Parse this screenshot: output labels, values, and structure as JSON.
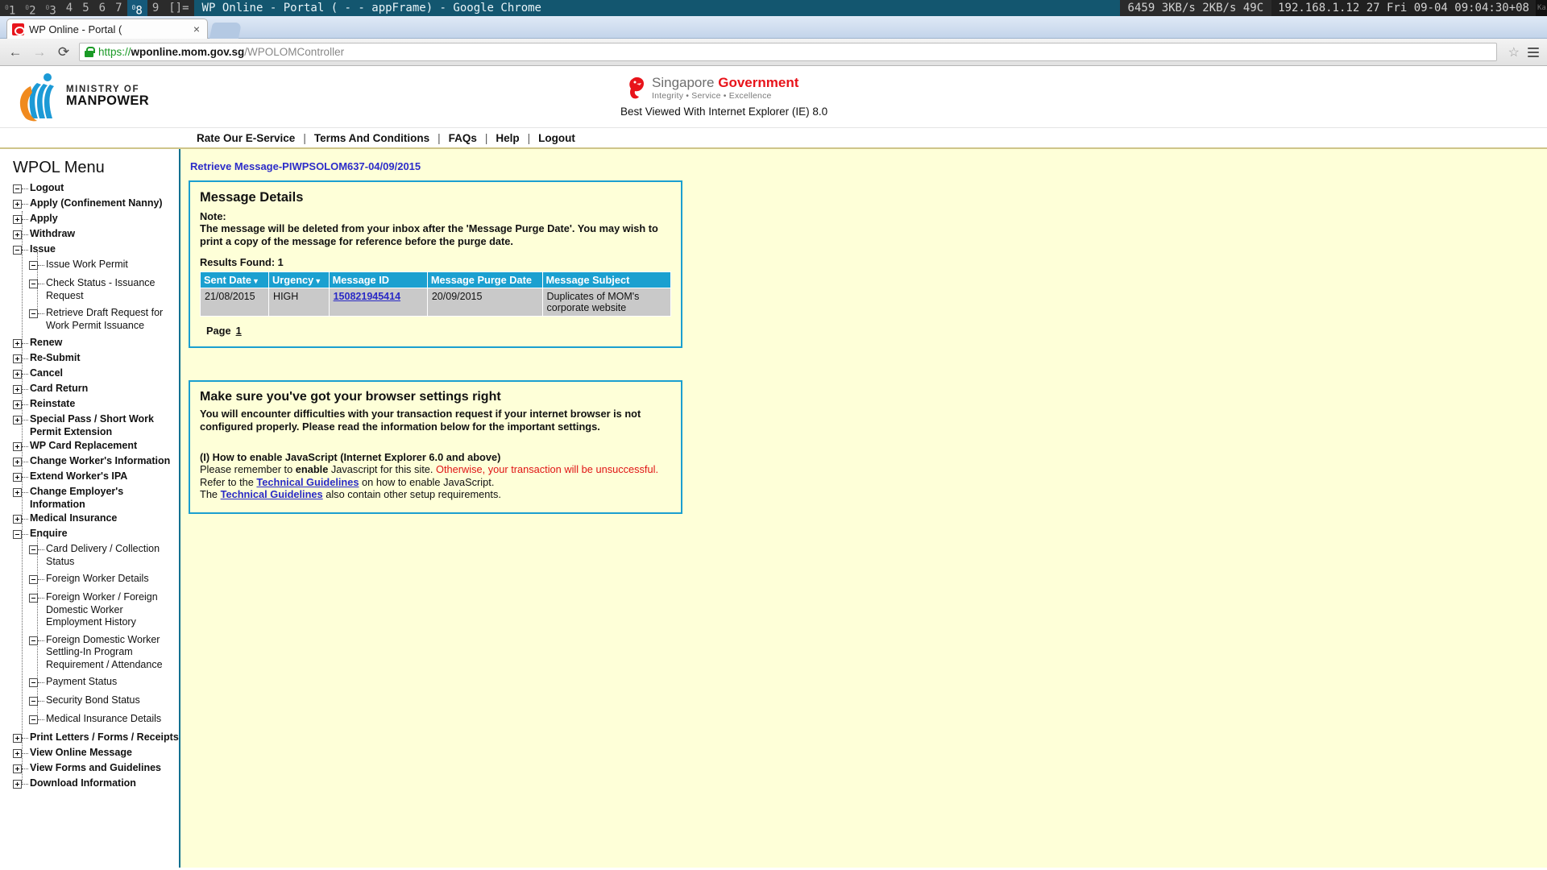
{
  "wm": {
    "workspaces": [
      {
        "sup": "0",
        "num": "1",
        "active": false
      },
      {
        "sup": "0",
        "num": "2",
        "active": false
      },
      {
        "sup": "0",
        "num": "3",
        "active": false
      },
      {
        "sup": "",
        "num": "4",
        "active": false
      },
      {
        "sup": "",
        "num": "5",
        "active": false
      },
      {
        "sup": "",
        "num": "6",
        "active": false
      },
      {
        "sup": "",
        "num": "7",
        "active": false
      },
      {
        "sup": "0",
        "num": "8",
        "active": true
      },
      {
        "sup": "",
        "num": "9",
        "active": false
      }
    ],
    "layout": "[]=",
    "window_title": "WP Online - Portal ( - - appFrame) - Google Chrome",
    "stats": "6459 3KB/s 2KB/s 49C",
    "clock": "192.168.1.12 27 Fri 09-04 09:04:30+08",
    "corner": "Kai"
  },
  "browser": {
    "tab_title": "WP Online - Portal (",
    "tab_close": "×",
    "back_icon": "←",
    "forward_icon": "→",
    "reload_icon": "⟳",
    "url_scheme": "https://",
    "url_host": "wponline.mom.gov.sg",
    "url_path": "/WPOLOMController",
    "star_icon": "☆"
  },
  "header": {
    "logo_line1": "MINISTRY OF",
    "logo_line2": "MANPOWER",
    "sg_line1_a": "Singapore ",
    "sg_line1_b": "Government",
    "sg_line2": "Integrity • Service • Excellence",
    "best_viewed": "Best Viewed With Internet Explorer (IE) 8.0"
  },
  "nav": {
    "items": [
      "Rate Our E-Service",
      "Terms And Conditions",
      "FAQs",
      "Help",
      "Logout"
    ],
    "separator": "|"
  },
  "sidebar": {
    "title": "WPOL Menu",
    "items": [
      {
        "label": "Logout",
        "level": 1,
        "state": "minus"
      },
      {
        "label": "Apply (Confinement Nanny)",
        "level": 1,
        "state": "plus"
      },
      {
        "label": "Apply",
        "level": 1,
        "state": "plus"
      },
      {
        "label": "Withdraw",
        "level": 1,
        "state": "plus"
      },
      {
        "label": "Issue",
        "level": 1,
        "state": "minus"
      },
      {
        "label": "Issue Work Permit",
        "level": 2,
        "state": "minus"
      },
      {
        "label": "Check Status - Issuance Request",
        "level": 2,
        "state": "minus"
      },
      {
        "label": "Retrieve Draft Request for Work Permit Issuance",
        "level": 2,
        "state": "minus"
      },
      {
        "label": "Renew",
        "level": 1,
        "state": "plus"
      },
      {
        "label": "Re-Submit",
        "level": 1,
        "state": "plus"
      },
      {
        "label": "Cancel",
        "level": 1,
        "state": "plus"
      },
      {
        "label": "Card Return",
        "level": 1,
        "state": "plus"
      },
      {
        "label": "Reinstate",
        "level": 1,
        "state": "plus"
      },
      {
        "label": "Special Pass / Short Work Permit Extension",
        "level": 1,
        "state": "plus"
      },
      {
        "label": "WP Card Replacement",
        "level": 1,
        "state": "plus"
      },
      {
        "label": "Change Worker's Information",
        "level": 1,
        "state": "plus"
      },
      {
        "label": "Extend Worker's IPA",
        "level": 1,
        "state": "plus"
      },
      {
        "label": "Change Employer's Information",
        "level": 1,
        "state": "plus"
      },
      {
        "label": "Medical Insurance",
        "level": 1,
        "state": "plus"
      },
      {
        "label": "Enquire",
        "level": 1,
        "state": "minus"
      },
      {
        "label": "Card Delivery / Collection Status",
        "level": 2,
        "state": "minus"
      },
      {
        "label": "Foreign Worker Details",
        "level": 2,
        "state": "minus"
      },
      {
        "label": "Foreign Worker / Foreign Domestic Worker Employment History",
        "level": 2,
        "state": "minus"
      },
      {
        "label": "Foreign Domestic Worker Settling-In Program Requirement / Attendance",
        "level": 2,
        "state": "minus"
      },
      {
        "label": "Payment Status",
        "level": 2,
        "state": "minus"
      },
      {
        "label": "Security Bond Status",
        "level": 2,
        "state": "minus"
      },
      {
        "label": "Medical Insurance Details",
        "level": 2,
        "state": "minus"
      },
      {
        "label": "Print Letters / Forms / Receipts",
        "level": 1,
        "state": "plus"
      },
      {
        "label": "View Online Message",
        "level": 1,
        "state": "plus"
      },
      {
        "label": "View Forms and Guidelines",
        "level": 1,
        "state": "plus"
      },
      {
        "label": "Download Information",
        "level": 1,
        "state": "plus"
      }
    ]
  },
  "content": {
    "breadcrumb": "Retrieve Message-PIWPSOLOM637-04/09/2015",
    "message_panel": {
      "heading": "Message Details",
      "note_label": "Note:",
      "note_body": "The message will be deleted from your inbox after the 'Message Purge Date'. You may wish to print a copy of the message for reference before the purge date.",
      "results_found": "Results Found: 1",
      "columns": [
        "Sent Date",
        "Urgency",
        "Message ID",
        "Message Purge Date",
        "Message Subject"
      ],
      "sortable": [
        true,
        true,
        false,
        false,
        false
      ],
      "sort_caret": "▼",
      "rows": [
        {
          "sent_date": "21/08/2015",
          "urgency": "HIGH",
          "message_id": "150821945414",
          "purge_date": "20/09/2015",
          "subject": "Duplicates of MOM's corporate website"
        }
      ],
      "pager_label": "Page",
      "pager_current": "1"
    },
    "browser_panel": {
      "heading": "Make sure you've got your browser settings right",
      "intro": "You will encounter difficulties with your transaction request if your internet browser is not configured properly. Please read the information below for the important settings.",
      "section_title": "(I) How to enable JavaScript (Internet Explorer 6.0 and above)",
      "line1_pre": "Please remember to ",
      "line1_bold": "enable",
      "line1_mid": " Javascript for this site. ",
      "line1_warn": "Otherwise, your transaction will be unsuccessful.",
      "line2_pre": "Refer to the ",
      "line2_link": "Technical Guidelines",
      "line2_post": " on how to enable JavaScript.",
      "line3_pre": "The ",
      "line3_link": "Technical Guidelines",
      "line3_post": " also contain other setup requirements."
    }
  },
  "colors": {
    "page_bg": "#feffd8",
    "panel_border": "#1ba0d0",
    "table_header": "#1ba0d0",
    "table_row": "#c9c9c9",
    "link": "#2a2ac6",
    "warn": "#e01414",
    "sidebar_border": "#0a6f8f",
    "sg_red": "#e8131a"
  }
}
